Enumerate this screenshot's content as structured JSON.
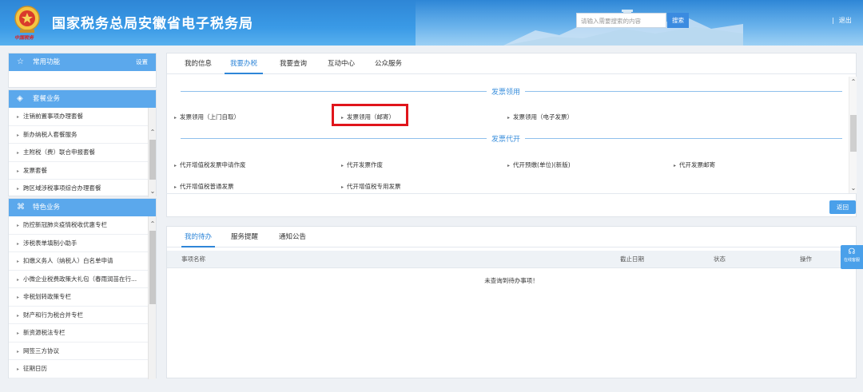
{
  "header": {
    "title": "国家税务总局安徽省电子税务局",
    "emblem_caption": "中国税务",
    "search_placeholder": "请输入需要搜索的内容",
    "search_button": "搜索",
    "separator": "|",
    "logout": "退出"
  },
  "sidebar": {
    "common": {
      "title": "常用功能",
      "settings": "设置",
      "icon": "star-icon"
    },
    "packages": {
      "title": "套餐业务",
      "icon": "layers-icon",
      "items": [
        {
          "label": "注销前置事项办理套餐"
        },
        {
          "label": "新办纳税人套餐服务"
        },
        {
          "label": "主附税（费）联合申报套餐"
        },
        {
          "label": "发票套餐"
        },
        {
          "label": "跨区域涉税事项综合办理套餐"
        }
      ]
    },
    "featured": {
      "title": "特色业务",
      "icon": "grid-icon",
      "items": [
        {
          "label": "防控新冠肺炎疫情税收优惠专栏"
        },
        {
          "label": "涉税表单填制小助手"
        },
        {
          "label": "扣缴义务人（纳税人）白名单申请"
        },
        {
          "label": "小微企业税费政策大礼包（春雨润苗在行..."
        },
        {
          "label": "非税划转政策专栏"
        },
        {
          "label": "财产和行为税合并专栏"
        },
        {
          "label": "新资源税法专栏"
        },
        {
          "label": "网签三方协议"
        },
        {
          "label": "征期日历"
        }
      ]
    }
  },
  "main": {
    "tabs": [
      {
        "label": "我的信息"
      },
      {
        "label": "我要办税"
      },
      {
        "label": "我要查询"
      },
      {
        "label": "互动中心"
      },
      {
        "label": "公众服务"
      }
    ],
    "active_tab": "我要办税",
    "sections": [
      {
        "title": "发票领用",
        "items": [
          {
            "label": "发票领用（上门自取）"
          },
          {
            "label": "发票领用（邮寄）"
          },
          {
            "label": "发票领用（电子发票）"
          }
        ]
      },
      {
        "title": "发票代开",
        "items": [
          {
            "label": "代开增值税发票申请作废"
          },
          {
            "label": "代开发票作废"
          },
          {
            "label": "代开预缴(单位)(新版)"
          },
          {
            "label": "代开发票邮寄"
          },
          {
            "label": "代开增值税普通发票"
          },
          {
            "label": "代开增值税专用发票"
          }
        ]
      }
    ],
    "back_button": "返回"
  },
  "todo": {
    "tabs": [
      {
        "label": "我的待办"
      },
      {
        "label": "服务提醒"
      },
      {
        "label": "通知公告"
      }
    ],
    "columns": [
      "事项名称",
      "截止日期",
      "状态",
      "操作"
    ],
    "empty_message": "未查询到待办事项！"
  },
  "online_service": {
    "label": "在线客服"
  },
  "colors": {
    "accent": "#2f86d8",
    "highlight": "#e0151b",
    "header": "#3a9ae6"
  }
}
